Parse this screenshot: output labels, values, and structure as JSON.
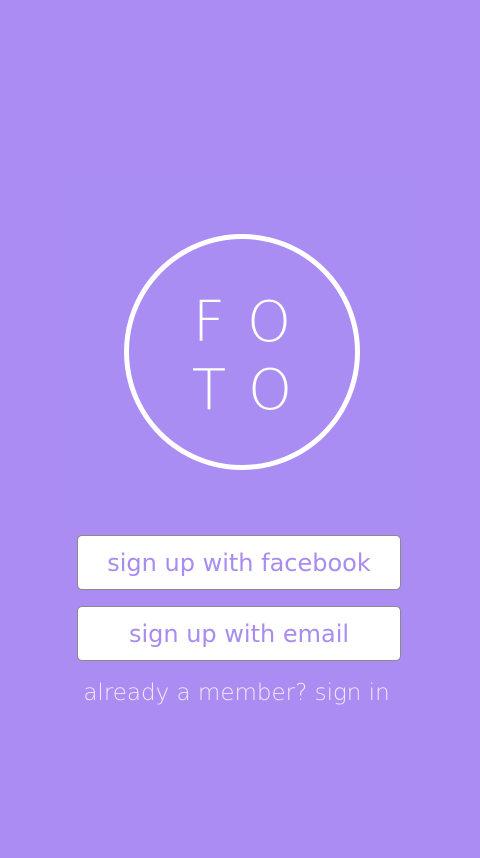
{
  "colors": {
    "background": "#ab8cf2",
    "button_background": "#ffffff",
    "button_text": "#a98cef",
    "logo": "#ffffff",
    "link_text": "#f0eafd"
  },
  "logo": {
    "icon": "foto-circle-logo",
    "line1": "FO",
    "line2": "TO"
  },
  "actions": {
    "facebook_label": "sign up with facebook",
    "email_label": "sign up with email",
    "signin_label": "already a member? sign in"
  }
}
